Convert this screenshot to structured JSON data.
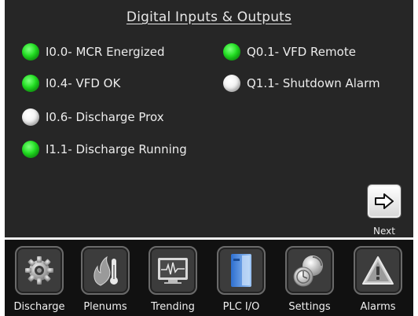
{
  "title": "Digital Inputs & Outputs",
  "inputs": [
    {
      "label": "I0.0- MCR Energized",
      "state": "on"
    },
    {
      "label": "I0.4- VFD OK",
      "state": "on"
    },
    {
      "label": "I0.6- Discharge Prox",
      "state": "off"
    },
    {
      "label": "I1.1- Discharge Running",
      "state": "on"
    }
  ],
  "outputs": [
    {
      "label": "Q0.1- VFD Remote",
      "state": "on"
    },
    {
      "label": "Q1.1- Shutdown Alarm",
      "state": "off"
    }
  ],
  "next": {
    "label": "Next",
    "icon": "arrow-right-icon"
  },
  "nav": [
    {
      "label": "Discharge",
      "icon": "gear-icon"
    },
    {
      "label": "Plenums",
      "icon": "flame-thermometer-icon"
    },
    {
      "label": "Trending",
      "icon": "trend-monitor-icon"
    },
    {
      "label": "PLC I/O",
      "icon": "plc-module-icon"
    },
    {
      "label": "Settings",
      "icon": "settings-icon"
    },
    {
      "label": "Alarms",
      "icon": "warning-icon"
    }
  ],
  "colors": {
    "led_on": "#22e022",
    "led_off": "#f2f2f2",
    "background": "#262626",
    "navbar": "#111111"
  }
}
